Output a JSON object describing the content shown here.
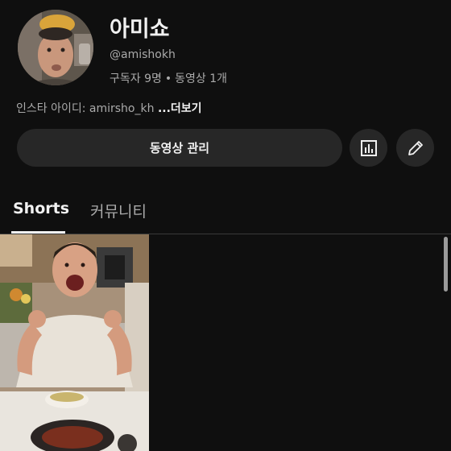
{
  "channel": {
    "name": "아미쇼",
    "handle": "@amishokh",
    "subscribers": "구독자 9명",
    "separator": "•",
    "videos": "동영상 1개",
    "description": "인스타 아이디: amirsho_kh",
    "more_label": "...더보기"
  },
  "actions": {
    "manage_label": "동영상 관리",
    "analytics_icon": "analytics-icon",
    "edit_icon": "pencil-icon"
  },
  "tabs": [
    {
      "label": "Shorts",
      "selected": true
    },
    {
      "label": "커뮤니티",
      "selected": false
    }
  ],
  "colors": {
    "background": "#0f0f0f",
    "button": "#272727",
    "primary_text": "#f1f1f1",
    "secondary_text": "#aaaaaa"
  }
}
